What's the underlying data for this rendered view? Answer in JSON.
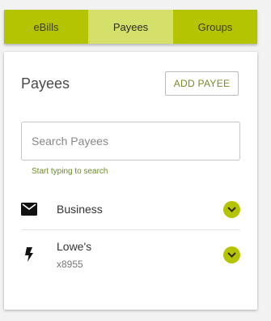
{
  "tabs": [
    {
      "label": "eBills",
      "active": false
    },
    {
      "label": "Payees",
      "active": true
    },
    {
      "label": "Groups",
      "active": false
    }
  ],
  "panel": {
    "title": "Payees",
    "add_button_label": "ADD PAYEE",
    "search": {
      "placeholder": "Search Payees",
      "value": "",
      "hint": "Start typing to search"
    },
    "payees": [
      {
        "name": "Business",
        "subtitle": "",
        "icon": "mail-icon"
      },
      {
        "name": "Lowe's",
        "subtitle": "x8955",
        "icon": "lightning-bolt-icon"
      }
    ]
  },
  "colors": {
    "accent": "#b5c400",
    "active_tab": "#d4e06a",
    "hint_text": "#6b8a2a"
  }
}
